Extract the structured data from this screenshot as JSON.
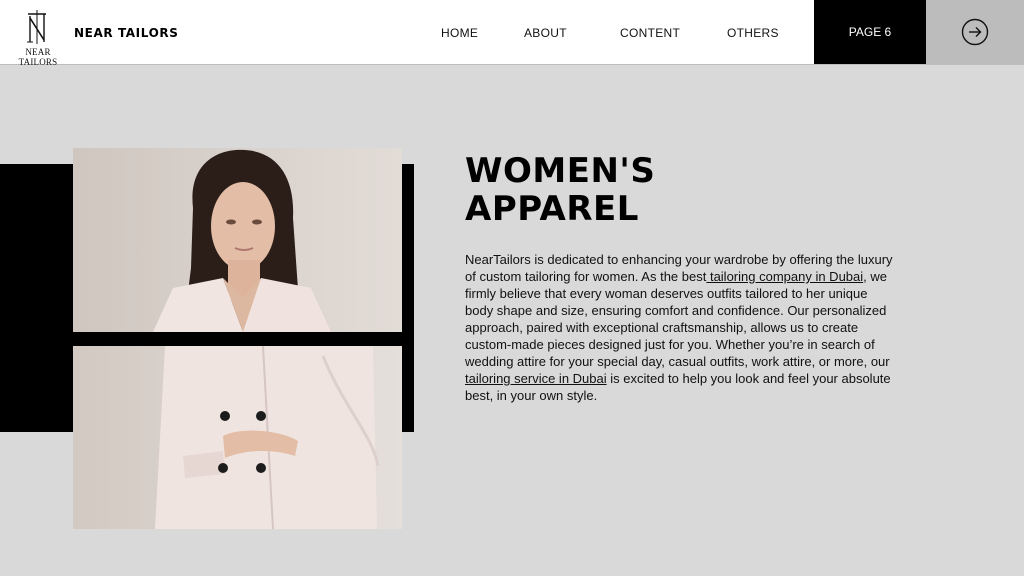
{
  "header": {
    "logo_text": "NEAR TAILORS",
    "brand": "NEAR TAILORS",
    "nav": [
      "HOME",
      "ABOUT",
      "CONTENT",
      "OTHERS"
    ],
    "page_label": "PAGE 6",
    "next_icon": "arrow-right-circle-icon"
  },
  "main": {
    "title_line1": "WOMEN'S",
    "title_line2": "APPAREL",
    "paragraph": {
      "part1": "NearTailors is dedicated to enhancing your wardrobe by offering the luxury of custom tailoring for women. As the best",
      "link1": " tailoring company in Dubai",
      "part2": ", we firmly believe that every woman deserves outfits tailored to her unique body shape and size, ensuring comfort and confidence. Our personalized approach, paired with exceptional craftsmanship, allows us to create custom-made pieces designed just for you. Whether you’re in search of wedding attire for your special day, casual outfits, work attire, or more, our",
      "link2": " tailoring service in Dubai",
      "part3": " is excited to help you look and feel your absolute best, in your own style."
    }
  },
  "colors": {
    "background": "#d9d9d9",
    "header_bg": "#ffffff",
    "page_box": "#000000",
    "next_box": "#bcbcbc",
    "accent_black": "#000000"
  }
}
